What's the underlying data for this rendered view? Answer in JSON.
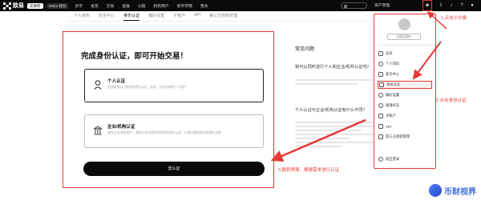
{
  "topbar": {
    "brand": "欧易",
    "mode_tabs": [
      "交易所",
      "Web3 钱包"
    ],
    "nav": [
      "买币",
      "发现",
      "交易",
      "金融",
      "公链",
      "机构用户",
      "新手学院",
      "更多"
    ],
    "asset_label": "资产管理"
  },
  "subnav": {
    "items": [
      "个人资料",
      "安全中心",
      "身份认证",
      "偏好设置",
      "子账户",
      "API",
      "第三方授权管理"
    ],
    "active_index": 2
  },
  "card": {
    "title": "完成身份认证，即可开始交易！",
    "options": [
      {
        "title": "个人认证",
        "desc": "适合使用自己的证件进行认证、验证，以及交易的个人用户"
      },
      {
        "title": "企业/机构认证",
        "desc": "适合企业/机构用户，使用公司注册文件等资料进行认证，以便开展机构业务相关交易"
      }
    ],
    "submit_label": "去认证"
  },
  "faq": {
    "title": "常见问题",
    "questions": [
      "我可以同时进行个人和企业/机构认证吗？",
      "个人认证与企业/机构认证有什么不同？"
    ]
  },
  "menu": {
    "tag": "已验证用户",
    "items": [
      "总览",
      "个人资料",
      "安全中心",
      "身份认证",
      "偏好设置",
      "邀请好友",
      "子账户",
      "API",
      "第三方授权管理",
      "退出登录"
    ],
    "highlight_index": 3
  },
  "annotations": {
    "step1": "1.点击小头像",
    "step2": "2.点击身份认证",
    "step3": "3.跳转界面，根据需求进行认证"
  },
  "watermark": "币财视界",
  "colors": {
    "accent_red": "#e53935",
    "topbar_bg": "#0a0a0a",
    "watermark_blue": "#3b6fe0"
  }
}
